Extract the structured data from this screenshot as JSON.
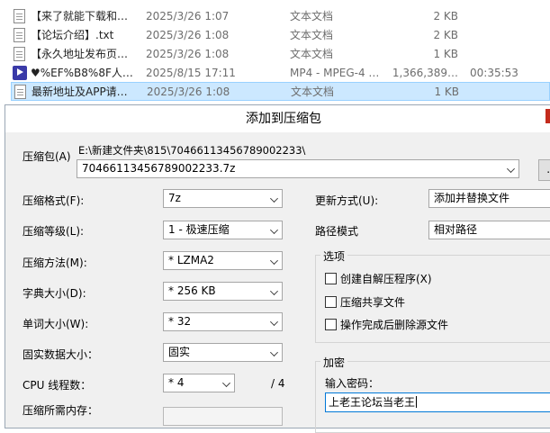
{
  "files": [
    {
      "name": "【来了就能下载和…",
      "date": "2025/3/26 1:07",
      "type": "文本文档",
      "size": "2 KB",
      "duration": "",
      "icon": "text-file-icon",
      "selected": false
    },
    {
      "name": "【论坛介绍】.txt",
      "date": "2025/3/26 1:08",
      "type": "文本文档",
      "size": "2 KB",
      "duration": "",
      "icon": "text-file-icon",
      "selected": false
    },
    {
      "name": "【永久地址发布页…",
      "date": "2025/3/26 1:08",
      "type": "文本文档",
      "size": "1 KB",
      "duration": "",
      "icon": "text-file-icon",
      "selected": false
    },
    {
      "name": "♥%EF%B8%8F人…",
      "date": "2025/8/15 17:11",
      "type": "MP4 - MPEG-4 …",
      "size": "1,366,389…",
      "duration": "00:35:53",
      "icon": "video-file-icon",
      "selected": false
    },
    {
      "name": "最新地址及APP请…",
      "date": "2025/3/26 1:08",
      "type": "文本文档",
      "size": "1 KB",
      "duration": "",
      "icon": "text-file-icon",
      "selected": true
    }
  ],
  "dialog": {
    "title": "添加到压缩包",
    "archive_label": "压缩包(A)",
    "archive_path": "E:\\新建文件夹\\815\\70466113456789002233\\",
    "archive_name": "70466113456789002233.7z",
    "browse_label": "...",
    "format_label": "压缩格式(F):",
    "format_value": "7z",
    "level_label": "压缩等级(L):",
    "level_value": "1 - 极速压缩",
    "method_label": "压缩方法(M):",
    "method_value": "* LZMA2",
    "dict_label": "字典大小(D):",
    "dict_value": "* 256 KB",
    "word_label": "单词大小(W):",
    "word_value": "* 32",
    "solid_label": "固实数据大小：",
    "solid_value": "固实",
    "cpu_label": "CPU 线程数：",
    "cpu_value": "* 4",
    "cpu_total": "/ 4",
    "memory_label": "压缩所需内存：",
    "update_label": "更新方式(U):",
    "update_value": "添加并替换文件",
    "pathmode_label": "路径模式",
    "pathmode_value": "相对路径",
    "options_title": "选项",
    "opt_sfx": "创建自解压程序(X)",
    "opt_shared": "压缩共享文件",
    "opt_delete": "操作完成后删除源文件",
    "encrypt_title": "加密",
    "password_label": "输入密码：",
    "password_value": "上老王论坛当老王"
  }
}
